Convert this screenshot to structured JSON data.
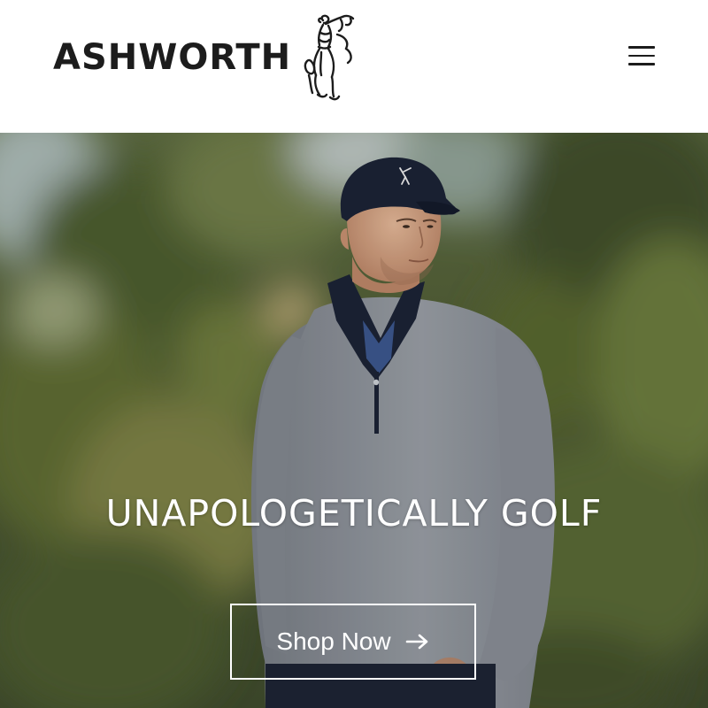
{
  "header": {
    "brand_name": "ASHWORTH",
    "logo_icon": "golfer-icon",
    "menu_icon": "hamburger-menu-icon"
  },
  "hero": {
    "headline": "UNAPOLOGETICALLY GOLF",
    "cta_label": "Shop Now",
    "cta_icon": "arrow-right-icon"
  },
  "colors": {
    "brand_text": "#1c1c1c",
    "header_bg": "#ffffff",
    "hero_text": "#ffffff",
    "cap_navy": "#1b2235",
    "pullover_gray": "#8a8f96"
  }
}
